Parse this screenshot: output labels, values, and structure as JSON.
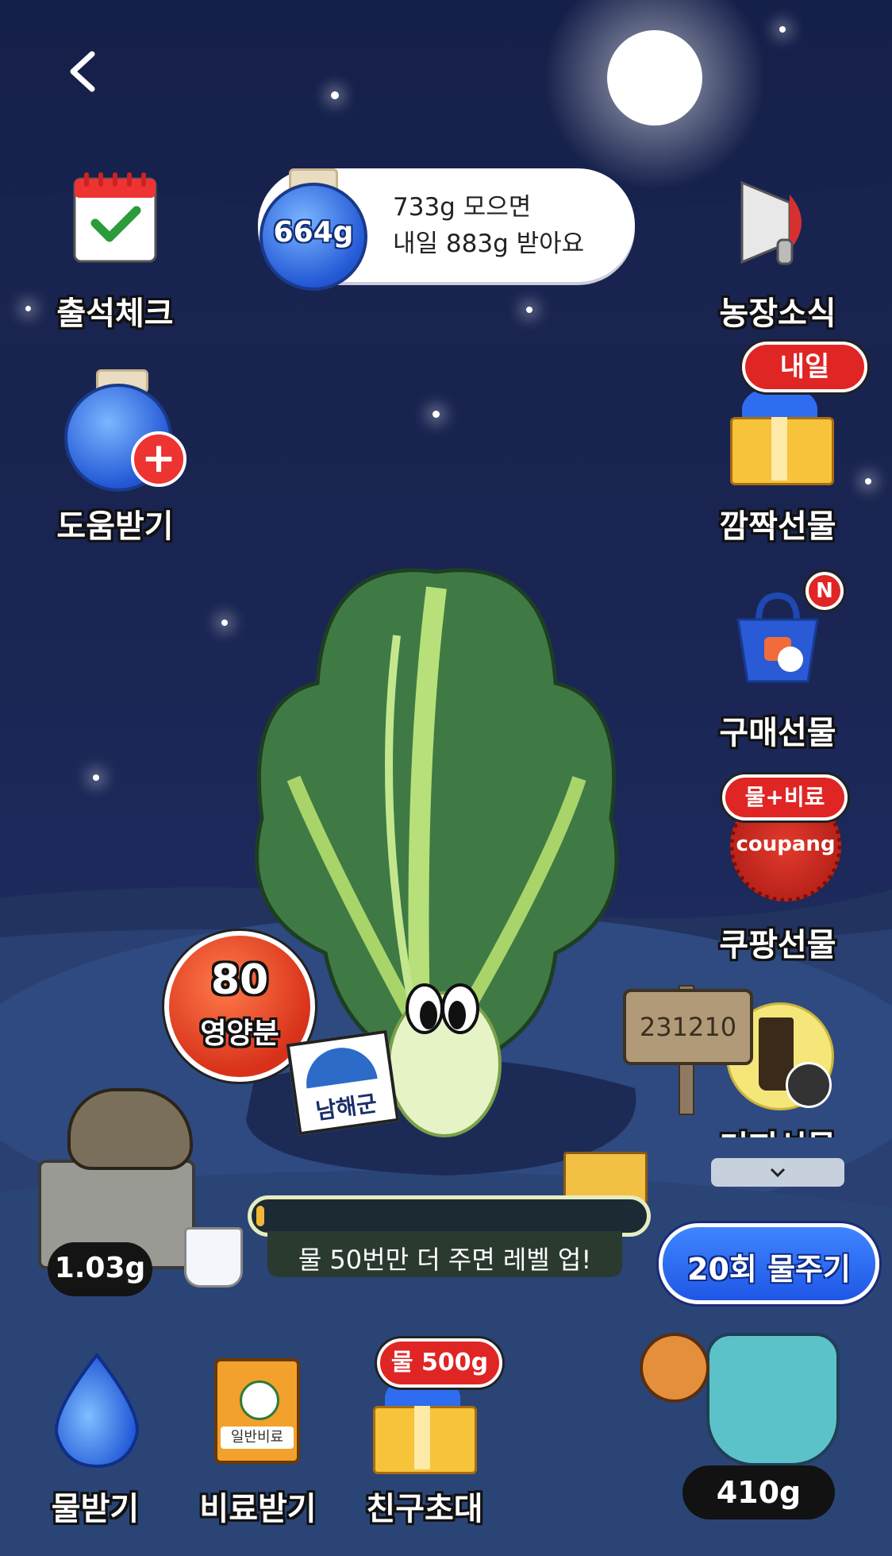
{
  "header": {
    "back_icon": "chevron-left-icon"
  },
  "water_tank": {
    "amount": "664g",
    "line1": "733g 모으면",
    "line2": "내일 883g 받아요"
  },
  "left_menu": [
    {
      "label": "출석체크",
      "icon": "calendar-check-icon"
    },
    {
      "label": "도움받기",
      "icon": "water-jar-plus-icon"
    }
  ],
  "right_menu": [
    {
      "label": "농장소식",
      "icon": "megaphone-icon"
    },
    {
      "label": "깜짝선물",
      "icon": "gift-box-icon",
      "badge": "내일"
    },
    {
      "label": "구매선물",
      "icon": "shopping-bag-icon",
      "badge": "N"
    },
    {
      "label": "쿠팡선물",
      "icon": "coupang-seal-icon",
      "badge": "물+비료",
      "seal_text": "coupang"
    },
    {
      "label": "커피선물",
      "icon": "coffee-cup-icon"
    }
  ],
  "nutrient": {
    "value": "80",
    "label": "영양분"
  },
  "region_sign": {
    "text": "남해군"
  },
  "signpost": {
    "text": "231210"
  },
  "turtle_amount": "1.03g",
  "progress": {
    "percent": 2,
    "message": "물 50번만 더 주면 레벨 업!"
  },
  "water_button": {
    "label": "20회 물주기"
  },
  "watering_can_amount": "410g",
  "bottom_menu": [
    {
      "label": "물받기",
      "icon": "water-drop-icon"
    },
    {
      "label": "비료받기",
      "icon": "fertilizer-bag-icon",
      "bag_text": "일반비료"
    },
    {
      "label": "친구초대",
      "icon": "gift-box-icon",
      "badge": "물 500g"
    }
  ],
  "colors": {
    "sky": "#15204a",
    "accent_blue": "#2f6df0",
    "badge_red": "#e02525",
    "leaf_green": "#3f7a45"
  }
}
